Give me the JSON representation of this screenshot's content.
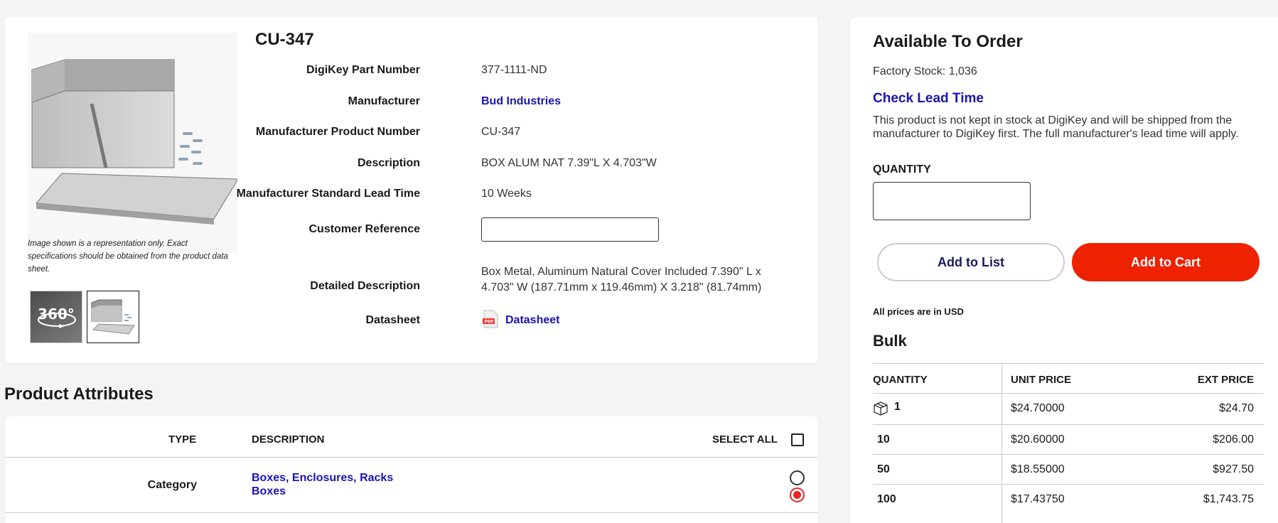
{
  "product": {
    "part_number": "CU-347",
    "image_note": "Image shown is a representation only. Exact specifications should be obtained from the product data sheet.",
    "thumb_360_label": "360°",
    "details": {
      "digikey_pn_label": "DigiKey Part Number",
      "digikey_pn": "377-1111-ND",
      "manufacturer_label": "Manufacturer",
      "manufacturer": "Bud Industries",
      "mpn_label": "Manufacturer Product Number",
      "mpn": "CU-347",
      "description_label": "Description",
      "description": "BOX ALUM NAT 7.39\"L X 4.703\"W",
      "lead_time_label": "Manufacturer Standard Lead Time",
      "lead_time": "10 Weeks",
      "customer_ref_label": "Customer Reference",
      "customer_ref_value": "",
      "detailed_desc_label": "Detailed Description",
      "detailed_desc": "Box Metal, Aluminum Natural Cover Included 7.390\" L x 4.703\" W (187.71mm x 119.46mm) X 3.218\" (81.74mm)",
      "datasheet_label": "Datasheet",
      "datasheet_link": "Datasheet"
    }
  },
  "attributes": {
    "section_title": "Product Attributes",
    "col_type": "TYPE",
    "col_description": "DESCRIPTION",
    "select_all": "SELECT ALL",
    "rows": [
      {
        "type": "Category",
        "values": [
          "Boxes, Enclosures, Racks",
          "Boxes"
        ],
        "selected_index": 1
      }
    ]
  },
  "order": {
    "title": "Available To Order",
    "factory_stock": "Factory Stock: 1,036",
    "check_lead_time": "Check Lead Time",
    "lead_note": "This product is not kept in stock at DigiKey and will be shipped from the manufacturer to DigiKey first. The full manufacturer's lead time will apply.",
    "quantity_label": "QUANTITY",
    "quantity_value": "",
    "add_to_list": "Add to List",
    "add_to_cart": "Add to Cart",
    "price_note": "All prices are in USD",
    "packaging": "Bulk",
    "price_table": {
      "headers": [
        "QUANTITY",
        "UNIT PRICE",
        "EXT PRICE"
      ],
      "rows": [
        {
          "qty": "1",
          "unit": "$24.70000",
          "ext": "$24.70"
        },
        {
          "qty": "10",
          "unit": "$20.60000",
          "ext": "$206.00"
        },
        {
          "qty": "50",
          "unit": "$18.55000",
          "ext": "$927.50"
        },
        {
          "qty": "100",
          "unit": "$17.43750",
          "ext": "$1,743.75"
        }
      ]
    }
  },
  "colors": {
    "link": "#1b14b5",
    "cart_button": "#ee2200",
    "radio_selected": "#ee2222"
  }
}
